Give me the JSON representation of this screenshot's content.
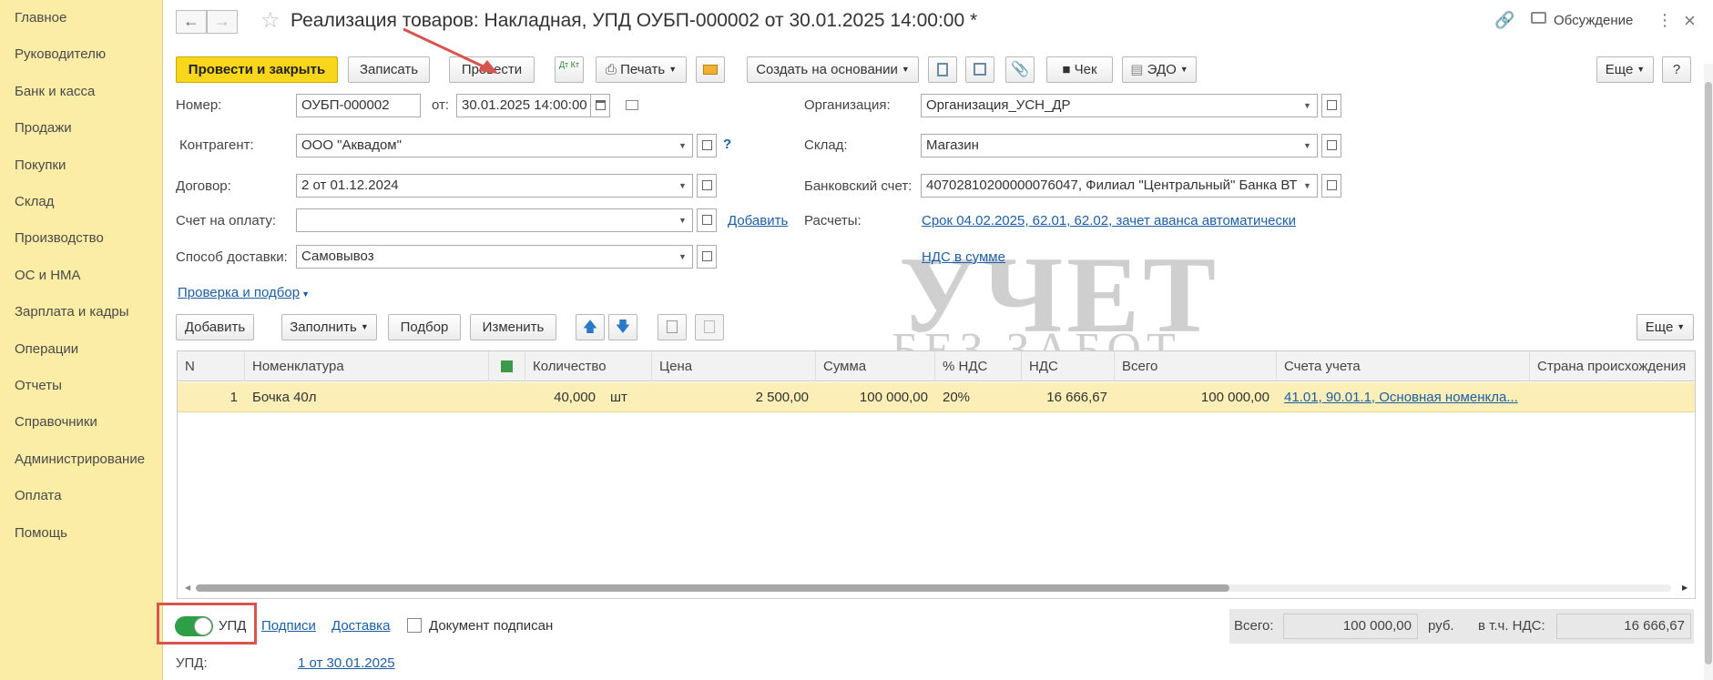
{
  "sidebar": {
    "items": [
      {
        "label": "Главное"
      },
      {
        "label": "Руководителю"
      },
      {
        "label": "Банк и касса"
      },
      {
        "label": "Продажи"
      },
      {
        "label": "Покупки"
      },
      {
        "label": "Склад"
      },
      {
        "label": "Производство"
      },
      {
        "label": "ОС и НМА"
      },
      {
        "label": "Зарплата и кадры"
      },
      {
        "label": "Операции"
      },
      {
        "label": "Отчеты"
      },
      {
        "label": "Справочники"
      },
      {
        "label": "Администрирование"
      },
      {
        "label": "Оплата"
      },
      {
        "label": "Помощь"
      }
    ]
  },
  "header": {
    "title": "Реализация товаров: Накладная, УПД ОУБП-000002 от 30.01.2025 14:00:00 *",
    "discussion": "Обсуждение"
  },
  "toolbar": {
    "post_close": "Провести и закрыть",
    "save": "Записать",
    "post": "Провести",
    "dt_kt": "Дт Кт",
    "print": "Печать",
    "create_based": "Создать на основании",
    "check": "Чек",
    "edo": "ЭДО",
    "more": "Еще",
    "help": "?"
  },
  "form": {
    "number_label": "Номер:",
    "number_value": "ОУБП-000002",
    "from_label": "от:",
    "date_value": "30.01.2025 14:00:00",
    "org_label": "Организация:",
    "org_value": "Организация_УСН_ДР",
    "contractor_label": "Контрагент:",
    "contractor_value": "ООО \"Аквадом\"",
    "warehouse_label": "Склад:",
    "warehouse_value": "Магазин",
    "contract_label": "Договор:",
    "contract_value": "2 от 01.12.2024",
    "bank_label": "Банковский счет:",
    "bank_value": "40702810200000076047, Филиал \"Центральный\" Банка ВТ",
    "invoice_label": "Счет на оплату:",
    "invoice_value": "",
    "add_link": "Добавить",
    "settlements_label": "Расчеты:",
    "settlements_value": "Срок 04.02.2025, 62.01, 62.02, зачет аванса автоматически",
    "delivery_label": "Способ доставки:",
    "delivery_value": "Самовывоз",
    "vat_link": "НДС в сумме",
    "check_link": "Проверка и подбор"
  },
  "table_toolbar": {
    "add": "Добавить",
    "fill": "Заполнить",
    "select": "Подбор",
    "change": "Изменить",
    "more": "Еще"
  },
  "table": {
    "columns": [
      "N",
      "Номенклатура",
      "Количество",
      "Цена",
      "Сумма",
      "% НДС",
      "НДС",
      "Всего",
      "Счета учета",
      "Страна происхождения"
    ],
    "rows": [
      {
        "n": "1",
        "item": "Бочка 40л",
        "qty": "40,000",
        "unit": "шт",
        "price": "2 500,00",
        "sum": "100 000,00",
        "vat_rate": "20%",
        "vat": "16 666,67",
        "total": "100 000,00",
        "accounts": "41.01, 90.01.1, Основная номенкла...",
        "country": ""
      }
    ]
  },
  "footer": {
    "upd_toggle": "УПД",
    "signatures": "Подписи",
    "delivery": "Доставка",
    "signed": "Документ подписан",
    "total_label": "Всего:",
    "total_value": "100 000,00",
    "currency": "руб.",
    "vat_label": "в т.ч. НДС:",
    "vat_value": "16 666,67",
    "upd_label": "УПД:",
    "upd_link": "1 от 30.01.2025"
  },
  "watermark": {
    "line1": "УЧЕТ",
    "line2": "БЕЗ ЗАБОТ"
  },
  "colors": {
    "sidebar": "#fbeca6",
    "primary_button": "#f7d61b",
    "highlight_box": "#d9534f",
    "arrow": "#d9534f",
    "link": "#1d5ea8",
    "toggle_on": "#2e9e47"
  }
}
